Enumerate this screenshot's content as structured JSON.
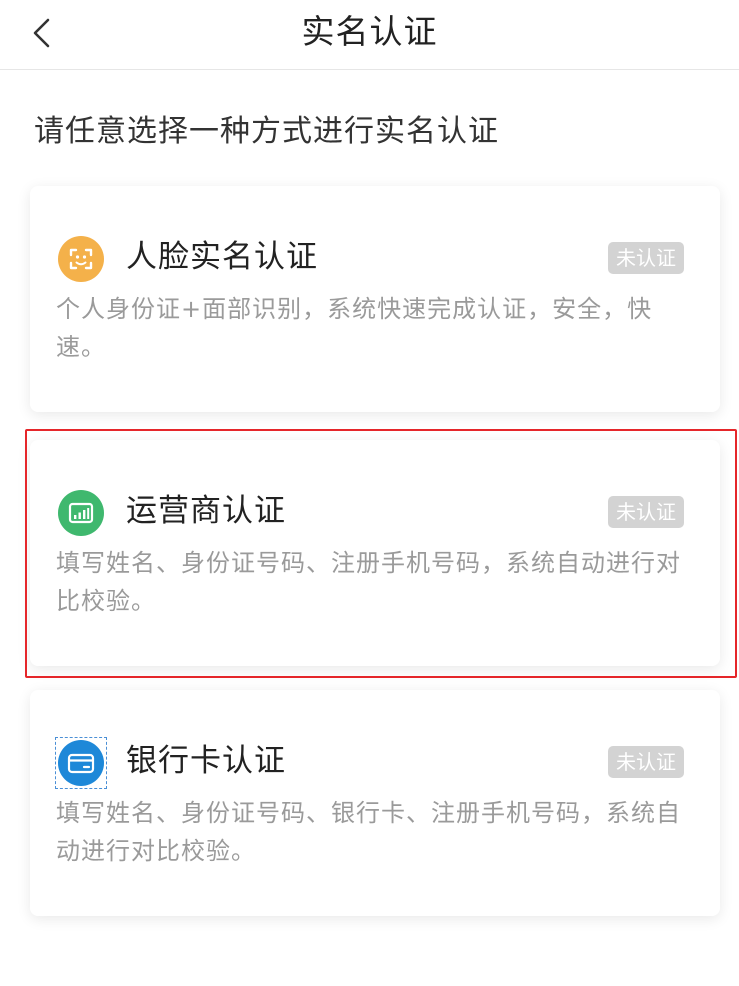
{
  "header": {
    "title": "实名认证"
  },
  "instruction": "请任意选择一种方式进行实名认证",
  "methods": [
    {
      "title": "人脸实名认证",
      "status": "未认证",
      "description": "个人身份证+面部识别，系统快速完成认证，安全，快速。",
      "icon": "face-scan-icon",
      "icon_color": "#f4b14a"
    },
    {
      "title": "运营商认证",
      "status": "未认证",
      "description": "填写姓名、身份证号码、注册手机号码，系统自动进行对比校验。",
      "icon": "signal-chart-icon",
      "icon_color": "#3fb86e",
      "highlighted": true
    },
    {
      "title": "银行卡认证",
      "status": "未认证",
      "description": "填写姓名、身份证号码、银行卡、注册手机号码，系统自动进行对比校验。",
      "icon": "bank-card-icon",
      "icon_color": "#1e88d8"
    }
  ],
  "colors": {
    "badge_bg": "#d3d3d3",
    "highlight_border": "#e5262a",
    "description_text": "#9a9a9a"
  }
}
